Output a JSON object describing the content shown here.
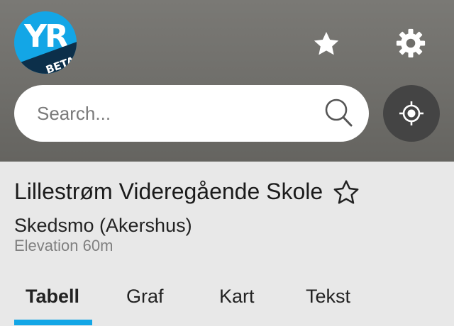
{
  "app": {
    "logo_text": "YR",
    "logo_badge": "BETA",
    "brand_color": "#13a6e6",
    "brand_dark": "#0c2f4a"
  },
  "header": {
    "favorites_icon": "star-filled-icon",
    "settings_icon": "gear-icon",
    "background_color": "#6e6d69"
  },
  "search": {
    "placeholder": "Search...",
    "value": "",
    "icon": "magnifier-icon"
  },
  "locate": {
    "icon": "crosshair-icon",
    "button_color": "#444444"
  },
  "location": {
    "name": "Lillestrøm Videregående Skole",
    "region": "Skedsmo (Akershus)",
    "elevation": "Elevation 60m",
    "favorite_icon": "star-outline-icon"
  },
  "tabs": [
    {
      "label": "Tabell",
      "active": true
    },
    {
      "label": "Graf",
      "active": false
    },
    {
      "label": "Kart",
      "active": false
    },
    {
      "label": "Tekst",
      "active": false
    }
  ]
}
